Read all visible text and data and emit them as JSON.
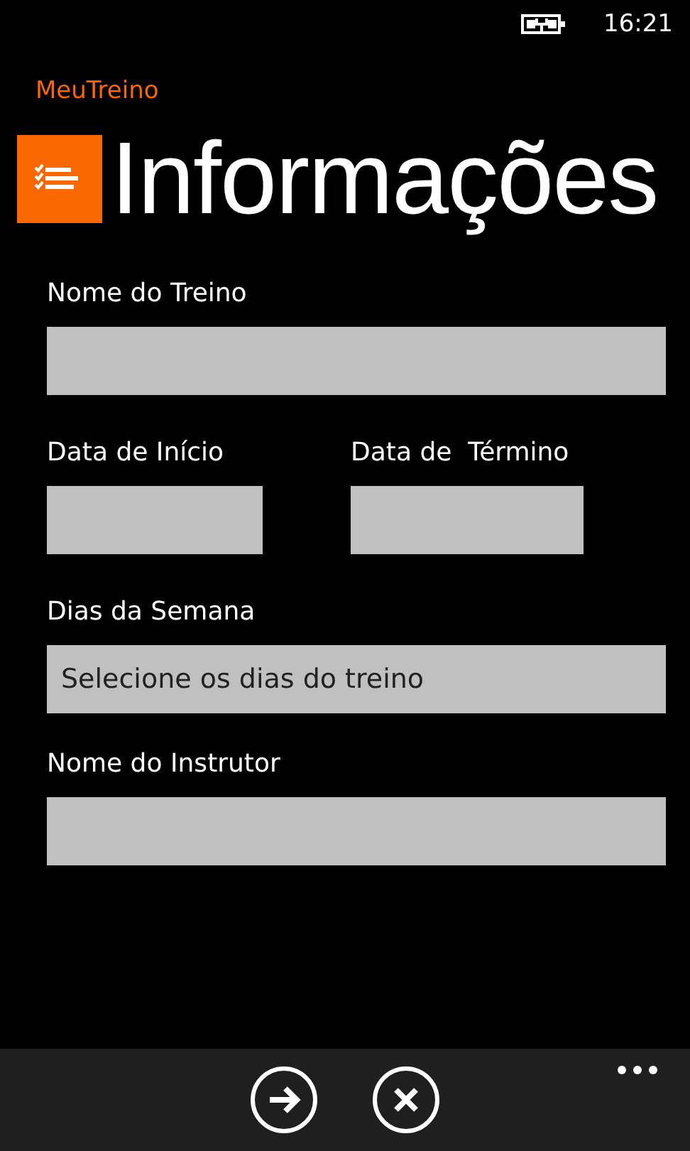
{
  "status_bar": {
    "time": "16:21"
  },
  "app_name": "MeuTreino",
  "page_title": "Informações",
  "fields": [
    {
      "kind": "text",
      "label": "Nome do Treino"
    },
    {
      "kind": "row",
      "children": [
        {
          "kind": "date",
          "label": "Data de Início"
        },
        {
          "kind": "date",
          "label": "Data de  Término"
        }
      ]
    },
    {
      "kind": "picker",
      "label": "Dias da Semana",
      "value": "Selecione os dias do treino"
    },
    {
      "kind": "text",
      "label": "Nome do Instrutor"
    }
  ],
  "app_bar": {
    "buttons": [
      {
        "kind": "next"
      },
      {
        "kind": "cancel"
      }
    ]
  }
}
